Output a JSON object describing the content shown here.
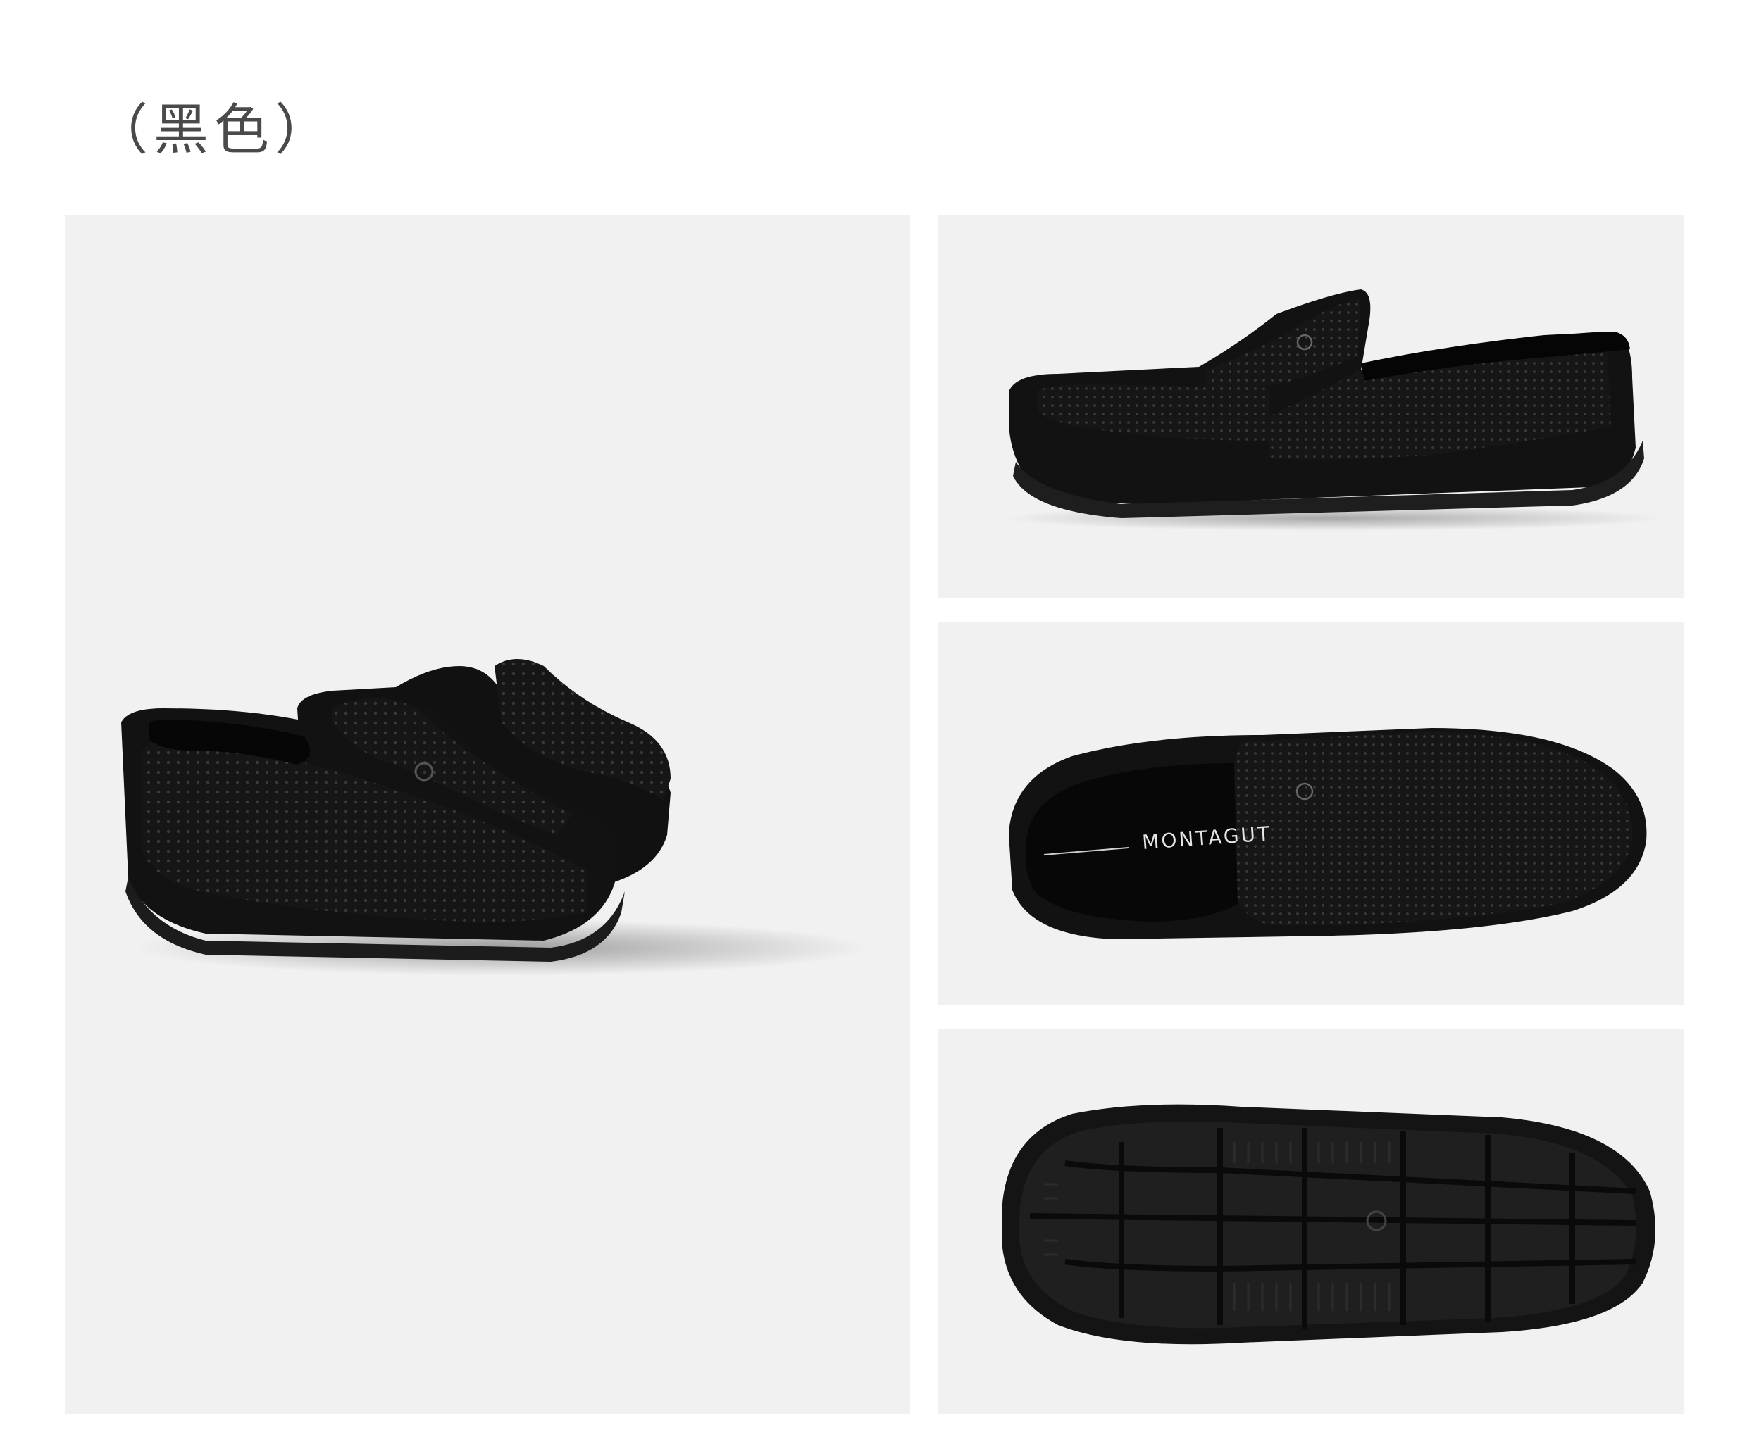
{
  "color_label": "（黑色）",
  "insole_brand": "MONTAGUT",
  "colors": {
    "background": "#ffffff",
    "panel": "#f1f1f1",
    "shoe": "#141414",
    "title_text": "#4a4a4a"
  }
}
